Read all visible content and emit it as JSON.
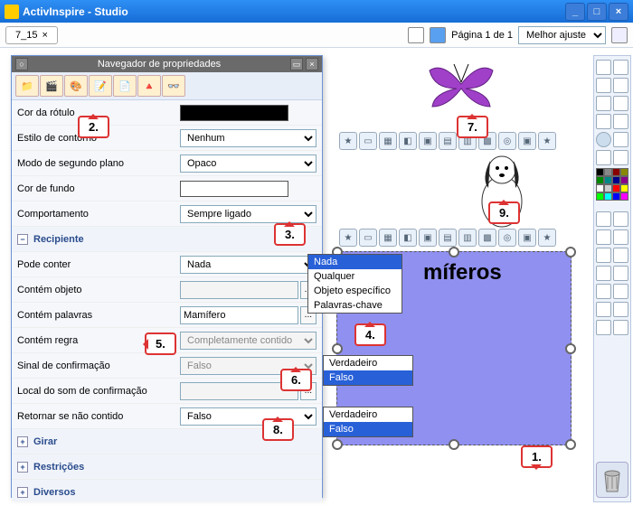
{
  "window": {
    "title": "ActivInspire - Studio"
  },
  "tab": {
    "name": "7_15"
  },
  "page_info": {
    "label": "Página 1 de 1"
  },
  "fit_combo": {
    "label": "Melhor ajuste"
  },
  "prop_panel": {
    "title": "Navegador de propriedades"
  },
  "rows": {
    "cor_rotulo": {
      "label": "Cor da rótulo"
    },
    "estilo_contorno": {
      "label": "Estilo de contorno",
      "value": "Nenhum"
    },
    "modo_segundo": {
      "label": "Modo de segundo plano",
      "value": "Opaco"
    },
    "cor_fundo": {
      "label": "Cor de fundo"
    },
    "comportamento": {
      "label": "Comportamento",
      "value": "Sempre ligado"
    },
    "recipiente": {
      "label": "Recipiente"
    },
    "pode_conter": {
      "label": "Pode conter",
      "value": "Nada",
      "options": [
        "Nada",
        "Qualquer",
        "Objeto específico",
        "Palavras-chave"
      ]
    },
    "contem_objeto": {
      "label": "Contém objeto",
      "value": ""
    },
    "contem_palavras": {
      "label": "Contém palavras",
      "value": "Mamífero"
    },
    "contem_regra": {
      "label": "Contém regra",
      "value": "Completamente contido"
    },
    "sinal_confirm": {
      "label": "Sinal de confirmação",
      "value": "Falso",
      "options": [
        "Verdadeiro",
        "Falso"
      ]
    },
    "local_som": {
      "label": "Local do som de confirmação",
      "value": ""
    },
    "retornar": {
      "label": "Retornar se não contido",
      "value": "Falso",
      "options": [
        "Verdadeiro",
        "Falso"
      ]
    },
    "girar": {
      "label": "Girar"
    },
    "restricoes": {
      "label": "Restrições"
    },
    "diversos": {
      "label": "Diversos"
    }
  },
  "canvas_text": "míferos",
  "callouts": {
    "c1": "1.",
    "c2": "2.",
    "c3": "3.",
    "c4": "4.",
    "c5": "5.",
    "c6": "6.",
    "c7": "7.",
    "c8": "8.",
    "c9": "9."
  },
  "palette_colors": [
    "#000",
    "#888",
    "#800",
    "#880",
    "#080",
    "#088",
    "#008",
    "#808",
    "#fff",
    "#ccc",
    "#f00",
    "#ff0",
    "#0f0",
    "#0ff",
    "#00f",
    "#f0f"
  ]
}
